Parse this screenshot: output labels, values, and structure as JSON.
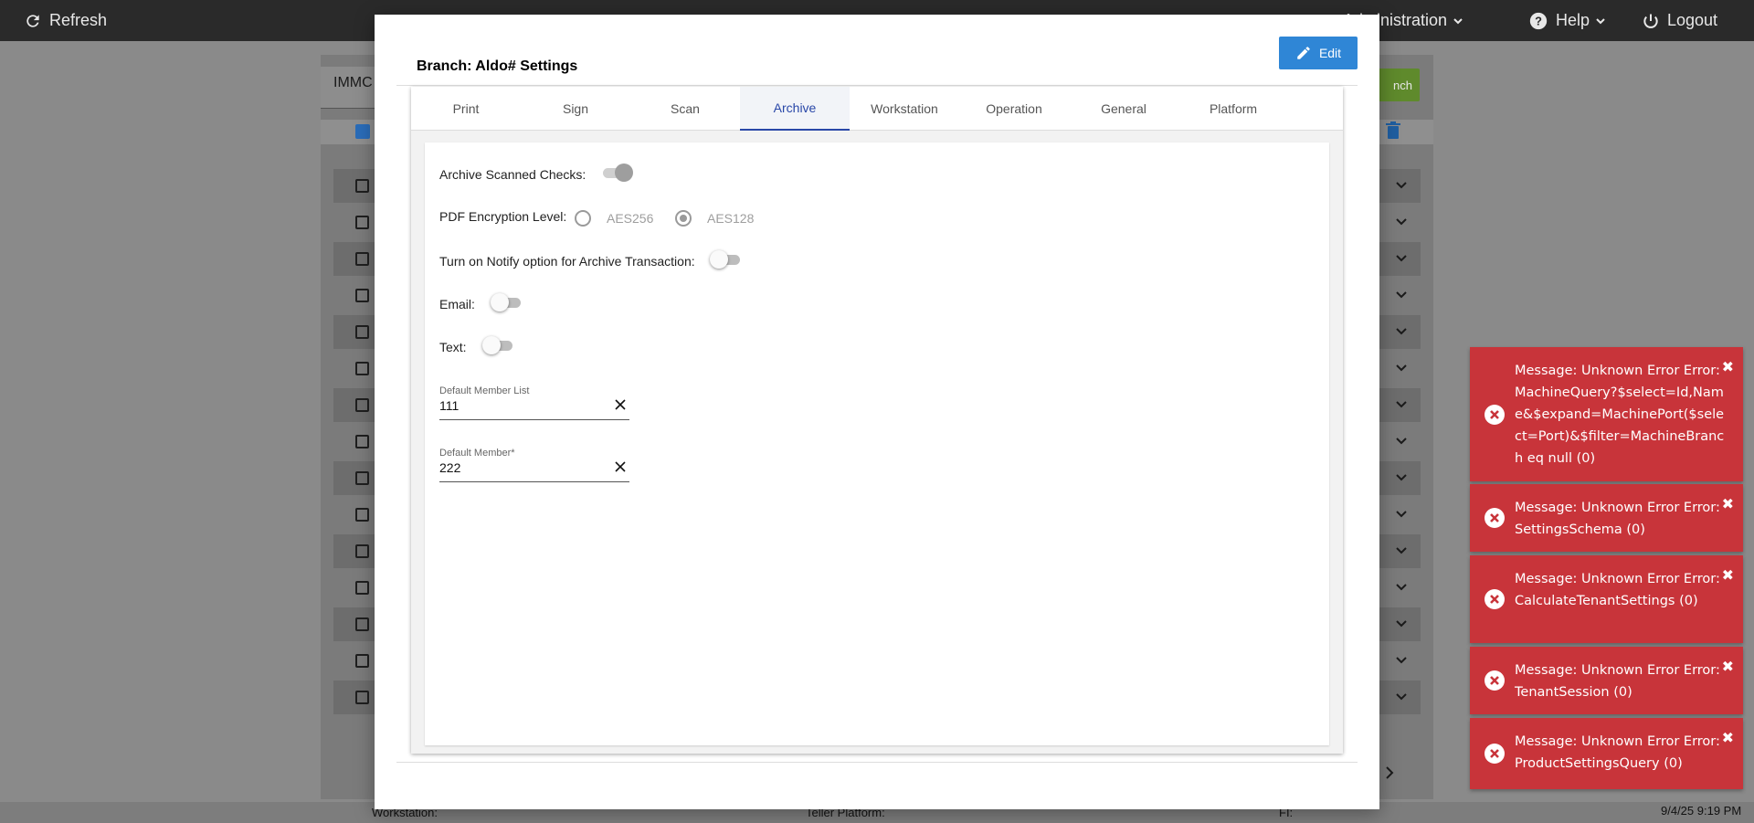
{
  "topbar": {
    "refresh": "Refresh",
    "administration": "Administration",
    "help": "Help",
    "logout": "Logout"
  },
  "background": {
    "search_value": "IMMC",
    "green_button": "nch",
    "status": {
      "workstation": "Workstation:",
      "teller_platform": "Teller Platform:",
      "fi": "FI:"
    }
  },
  "modal": {
    "title": "Branch: Aldo# Settings",
    "edit_label": "Edit",
    "tabs": [
      "Print",
      "Sign",
      "Scan",
      "Archive",
      "Workstation",
      "Operation",
      "General",
      "Platform"
    ],
    "active_tab": "Archive",
    "archive": {
      "archive_scanned_checks_label": "Archive Scanned Checks:",
      "archive_scanned_checks_on": true,
      "pdf_encryption_label": "PDF Encryption Level:",
      "pdf_options": [
        "AES256",
        "AES128"
      ],
      "pdf_selected": "AES128",
      "notify_label": "Turn on Notify option for Archive Transaction:",
      "notify_on": false,
      "email_label": "Email:",
      "email_on": false,
      "text_label": "Text:",
      "text_on": false,
      "default_member_list_label": "Default Member List",
      "default_member_list_value": "111",
      "default_member_label": "Default Member*",
      "default_member_value": "222"
    }
  },
  "toasts": [
    {
      "message": "Message: Unknown Error Error: MachineQuery?$select=Id,Name&$expand=MachinePort($select=Port)&$filter=MachineBranch eq null (0)"
    },
    {
      "message": "Message: Unknown Error Error: SettingsSchema (0)"
    },
    {
      "message": "Message: Unknown Error Error: CalculateTenantSettings (0)"
    },
    {
      "message": "Message: Unknown Error Error: TenantSession (0)"
    },
    {
      "message": "Message: Unknown Error Error: ProductSettingsQuery (0)"
    }
  ],
  "clock": "9/4/25 9:19 PM",
  "colors": {
    "accent": "#2947a8",
    "edit_button": "#2f86d6",
    "toast": "#c8343a",
    "topbar": "#2a2a2a"
  }
}
